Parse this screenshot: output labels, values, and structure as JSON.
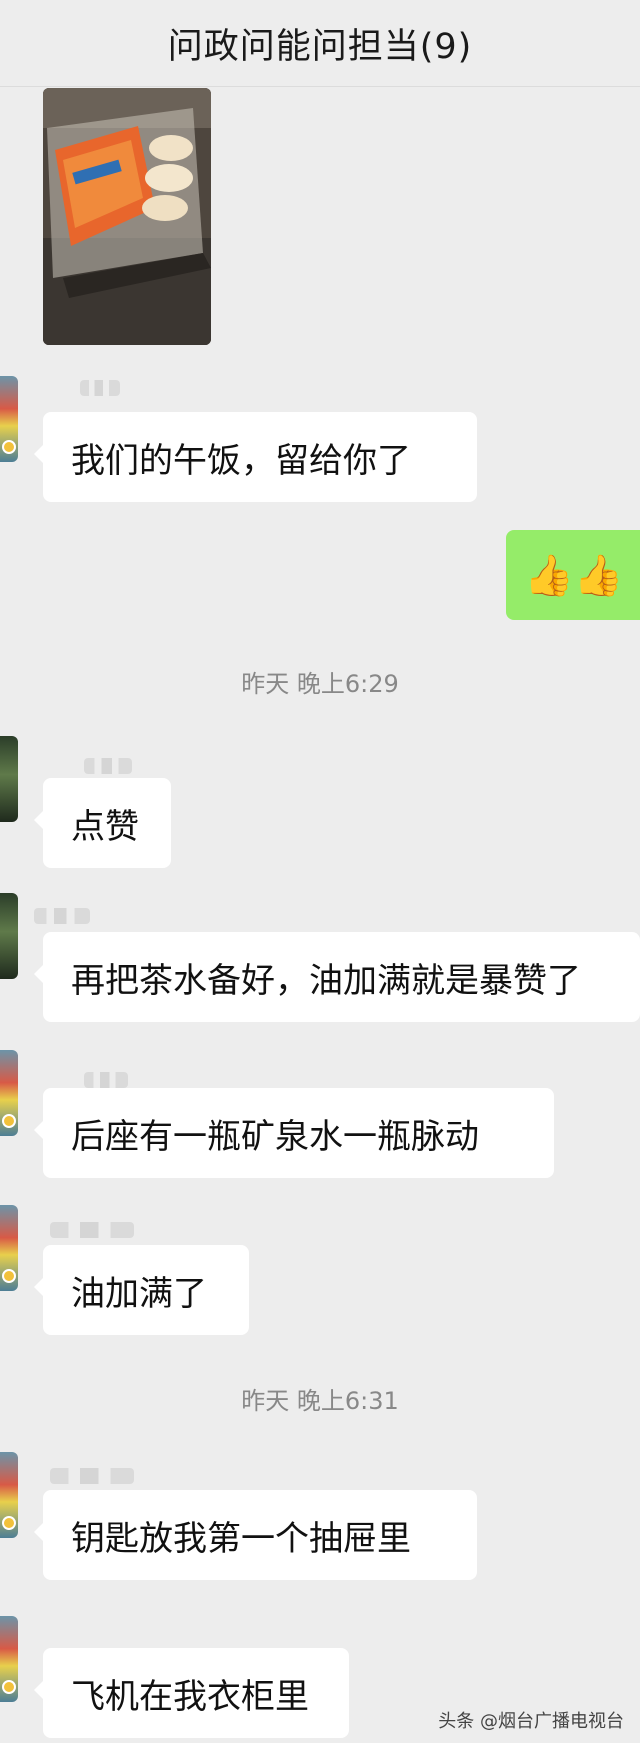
{
  "header": {
    "title": "问政问能问担当(9)"
  },
  "messages": [
    {
      "type": "image",
      "from": "other"
    },
    {
      "type": "text",
      "from": "other",
      "text": "我们的午饭，留给你了"
    },
    {
      "type": "text",
      "from": "me",
      "text": "👍👍"
    },
    {
      "type": "timestamp",
      "text": "昨天 晚上6:29"
    },
    {
      "type": "text",
      "from": "other",
      "text": "点赞"
    },
    {
      "type": "text",
      "from": "other",
      "text": "再把茶水备好，油加满就是暴赞了"
    },
    {
      "type": "text",
      "from": "other",
      "text": "后座有一瓶矿泉水一瓶脉动"
    },
    {
      "type": "text",
      "from": "other",
      "text": "油加满了"
    },
    {
      "type": "timestamp",
      "text": "昨天 晚上6:31"
    },
    {
      "type": "text",
      "from": "other",
      "text": "钥匙放我第一个抽屉里"
    },
    {
      "type": "text",
      "from": "other",
      "text": "飞机在我衣柜里"
    }
  ],
  "watermark": "头条 @烟台广播电视台",
  "colors": {
    "background": "#ededed",
    "bubble_other": "#ffffff",
    "bubble_me": "#95ec69",
    "timestamp": "#888888"
  }
}
